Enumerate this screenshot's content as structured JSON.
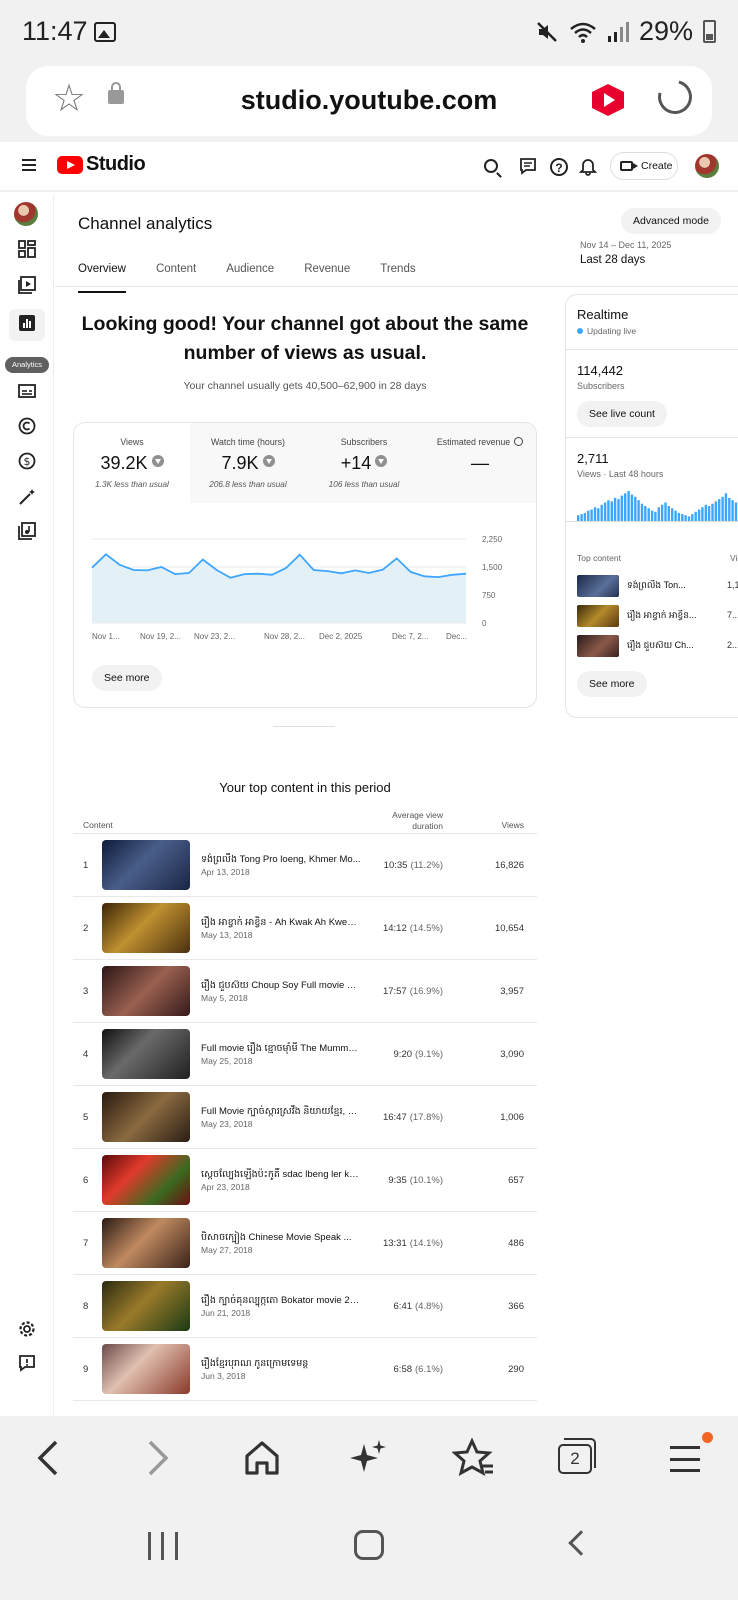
{
  "status_bar": {
    "time": "11:47",
    "battery": "29%"
  },
  "browser": {
    "url": "studio.youtube.com",
    "tabs_count": "2"
  },
  "header": {
    "logo_text": "Studio",
    "create_label": "Create"
  },
  "rail": {
    "analytics_tooltip": "Analytics"
  },
  "page": {
    "title": "Channel analytics",
    "advanced_mode": "Advanced mode",
    "tabs": [
      "Overview",
      "Content",
      "Audience",
      "Revenue",
      "Trends"
    ],
    "date_range": "Nov 14 – Dec 11, 2025",
    "date_label": "Last 28 days"
  },
  "summary": {
    "headline": "Looking good! Your channel got about the same number of views as usual.",
    "subhead": "Your channel usually gets 40,500–62,900 in 28 days"
  },
  "metrics": [
    {
      "label": "Views",
      "value": "39.2K",
      "note": "1.3K less than usual"
    },
    {
      "label": "Watch time (hours)",
      "value": "7.9K",
      "note": "206.8 less than usual"
    },
    {
      "label": "Subscribers",
      "value": "+14",
      "note": "106 less than usual"
    },
    {
      "label": "Estimated revenue",
      "value": "—",
      "note": ""
    }
  ],
  "chart_data": {
    "type": "area",
    "title": "",
    "xlabel": "",
    "ylabel": "",
    "x_tick_labels": [
      "Nov 1...",
      "Nov 19, 2...",
      "Nov 23, 2...",
      "Nov 28, 2...",
      "Dec 2, 2025",
      "Dec 7, 2...",
      "Dec..."
    ],
    "y_tick_labels": [
      "2,250",
      "1,500",
      "750",
      "0"
    ],
    "ylim": [
      0,
      2250
    ],
    "grid": true,
    "color": "#3ea6ff",
    "fill": "#e3f1f7",
    "values": [
      1480,
      1840,
      1560,
      1420,
      1410,
      1500,
      1310,
      1340,
      1700,
      1420,
      1210,
      1310,
      1320,
      1290,
      1470,
      1830,
      1420,
      1390,
      1330,
      1410,
      1340,
      1430,
      1730,
      1370,
      1250,
      1230,
      1290,
      1320
    ]
  },
  "see_more_label": "See more",
  "top_content": {
    "title": "Your top content in this period",
    "headers": {
      "content": "Content",
      "avd": "Average view duration",
      "views": "Views"
    },
    "rows": [
      {
        "idx": "1",
        "title": "ទង់ព្រលឹង Tong Pro loeng, Khmer Mo...",
        "date": "Apr 13, 2018",
        "avd": "10:35",
        "pct": "(11.2%)",
        "views": "16,826"
      },
      {
        "idx": "2",
        "title": "រឿង អាខ្វាក់ អាខ្វិន - Ah Kwak Ah Kwen -...",
        "date": "May 13, 2018",
        "avd": "14:12",
        "pct": "(14.5%)",
        "views": "10,654"
      },
      {
        "idx": "3",
        "title": "រឿង ជួបស៊យ Choup Soy Full movie H...",
        "date": "May 5, 2018",
        "avd": "17:57",
        "pct": "(16.9%)",
        "views": "3,957"
      },
      {
        "idx": "4",
        "title": "Full movie រឿង ខ្មោចម៉ាំមី The Mummy ...",
        "date": "May 25, 2018",
        "avd": "9:20",
        "pct": "(9.1%)",
        "views": "3,090"
      },
      {
        "idx": "5",
        "title": "Full Movie ក្បាច់ស្ការស្រវឹង និយាយខ្មែរ, Dr...",
        "date": "May 23, 2018",
        "avd": "16:47",
        "pct": "(17.8%)",
        "views": "1,006"
      },
      {
        "idx": "6",
        "title": "ស្តេចល្បែងឡើងប៉ះកូតិ៍ sdac lbeng ler ker...",
        "date": "Apr 23, 2018",
        "avd": "9:35",
        "pct": "(10.1%)",
        "views": "657"
      },
      {
        "idx": "7",
        "title": "បិសាចក្បៀង Chinese Movie Speak ...",
        "date": "May 27, 2018",
        "avd": "13:31",
        "pct": "(14.1%)",
        "views": "486"
      },
      {
        "idx": "8",
        "title": "រឿង ក្បាច់គុនល្បុក្កតោ Bokator movie 20...",
        "date": "Jun 21, 2018",
        "avd": "6:41",
        "pct": "(4.8%)",
        "views": "366"
      },
      {
        "idx": "9",
        "title": "រឿងខ្មែរបុរាណ កូនក្រោមទេមន្ត",
        "date": "Jun 3, 2018",
        "avd": "6:58",
        "pct": "(6.1%)",
        "views": "290"
      }
    ]
  },
  "realtime": {
    "title": "Realtime",
    "live_label": "Updating live",
    "subscribers_value": "114,442",
    "subscribers_label": "Subscribers",
    "see_live_count": "See live count",
    "views_value": "2,711",
    "views_label": "Views · Last 48 hours",
    "top_content_label": "Top content",
    "views_col_label": "Views",
    "top_content": [
      {
        "title": "ទង់ព្រលឹង Ton...",
        "views": "1,1..."
      },
      {
        "title": "រឿង អាខ្វាក់ អាខ្វិន...",
        "views": "7..."
      },
      {
        "title": "រឿង ជួបស៊យ Ch...",
        "views": "2..."
      }
    ],
    "see_more": "See more",
    "bars": [
      5,
      6,
      7,
      9,
      10,
      12,
      11,
      14,
      16,
      18,
      17,
      20,
      19,
      22,
      24,
      26,
      23,
      21,
      18,
      15,
      13,
      11,
      9,
      8,
      12,
      14,
      16,
      13,
      11,
      9,
      7,
      6,
      5,
      4,
      6,
      8,
      10,
      12,
      14,
      13,
      15,
      17,
      19,
      21,
      24,
      20,
      18,
      16,
      22,
      26,
      23,
      19,
      14,
      10,
      8,
      6
    ]
  },
  "colors": {
    "accent": "#ff0000",
    "chart_line": "#3ea6ff",
    "chart_fill": "#e3f1f7",
    "badge": "#f26522"
  }
}
